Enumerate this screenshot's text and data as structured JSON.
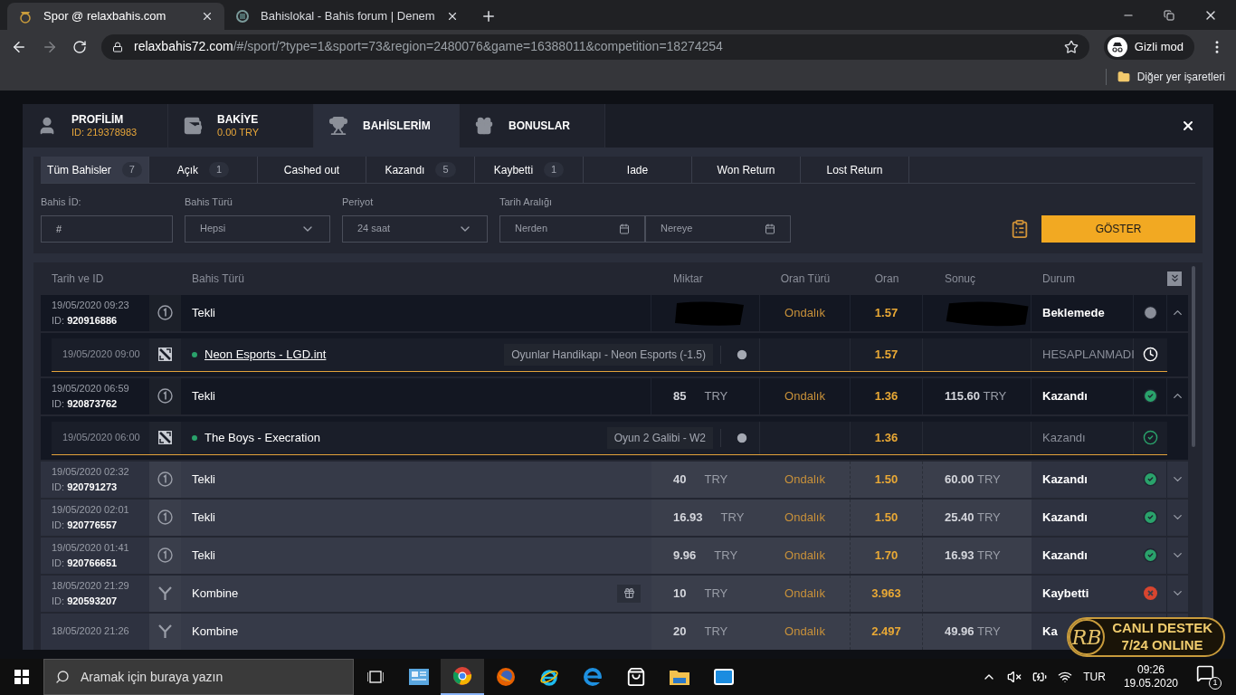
{
  "browser": {
    "tabs": [
      {
        "title": "Spor @ relaxbahis.com",
        "selected": true
      },
      {
        "title": "Bahislokal - Bahis forum | Denem",
        "selected": false
      }
    ],
    "url": {
      "domain": "relaxbahis72.com",
      "path": "/#/sport/?type=1&sport=73&region=2480076&game=16388011&competition=18274254"
    },
    "profile_label": "Gizli mod",
    "bookmarks": [
      "Diğer yer işaretleri"
    ]
  },
  "account_tabs": [
    {
      "label": "PROFİLİM",
      "sublabel": "ID: 219378983",
      "selected": false
    },
    {
      "label": "BAKİYE",
      "sublabel": "0.00 TRY",
      "selected": false
    },
    {
      "label": "BAHİSLERİM",
      "selected": true
    },
    {
      "label": "BONUSLAR",
      "selected": false
    }
  ],
  "bet_filters": [
    {
      "label": "Tüm Bahisler",
      "count": "7",
      "selected": true
    },
    {
      "label": "Açık",
      "count": "1",
      "selected": false
    },
    {
      "label": "Cashed out",
      "selected": false
    },
    {
      "label": "Kazandı",
      "count": "5",
      "selected": false
    },
    {
      "label": "Kaybetti",
      "count": "1",
      "selected": false
    },
    {
      "label": "Iade",
      "selected": false
    },
    {
      "label": "Won Return",
      "selected": false
    },
    {
      "label": "Lost Return",
      "selected": false
    }
  ],
  "filters": {
    "bet_id": {
      "label": "Bahis İD:",
      "placeholder": "#"
    },
    "bet_type": {
      "label": "Bahis Türü",
      "value": "Hepsi"
    },
    "period": {
      "label": "Periyot",
      "value": "24 saat"
    },
    "date_range": {
      "label": "Tarih Aralığı",
      "from_placeholder": "Nerden",
      "to_placeholder": "Nereye"
    },
    "submit": "GÖSTER"
  },
  "table": {
    "columns": [
      "Tarih ve ID",
      "Bahis Türü",
      "Miktar",
      "Oran Türü",
      "Oran",
      "Sonuç",
      "Durum"
    ],
    "rows": [
      {
        "kind": "bet",
        "date": "19/05/2020 09:23",
        "id_label": "ID:",
        "id": "920916886",
        "type": {
          "text": "Tekli",
          "kind": "single"
        },
        "redacted": true,
        "odds_type": "Ondalık",
        "odds": "1.57",
        "status": {
          "text": "Beklemede",
          "kind": "pending"
        },
        "expanded": true
      },
      {
        "kind": "selection",
        "date": "19/05/2020 09:00",
        "match": "Neon Esports - LGD.int",
        "link": true,
        "market": "Oyunlar Handikapı - Neon Esports (-1.5)",
        "odds": "1.57",
        "status": {
          "text": "HESAPLANMADI",
          "kind": "pending"
        }
      },
      {
        "kind": "bet",
        "date": "19/05/2020 06:59",
        "id_label": "ID:",
        "id": "920873762",
        "type": {
          "text": "Tekli",
          "kind": "single"
        },
        "amount": "85",
        "currency": "TRY",
        "odds_type": "Ondalık",
        "odds": "1.36",
        "result": "115.60",
        "result_currency": "TRY",
        "status": {
          "text": "Kazandı",
          "kind": "won"
        },
        "expanded": true
      },
      {
        "kind": "selection",
        "date": "19/05/2020 06:00",
        "match": "The Boys - Execration",
        "link": false,
        "market": "Oyun 2 Galibi - W2",
        "odds": "1.36",
        "status": {
          "text": "Kazandı",
          "kind": "won"
        }
      },
      {
        "kind": "bet",
        "date": "19/05/2020 02:32",
        "id_label": "ID:",
        "id": "920791273",
        "type": {
          "text": "Tekli",
          "kind": "single"
        },
        "amount": "40",
        "currency": "TRY",
        "odds_type": "Ondalık",
        "odds": "1.50",
        "result": "60.00",
        "result_currency": "TRY",
        "status": {
          "text": "Kazandı",
          "kind": "won"
        },
        "expanded": false
      },
      {
        "kind": "bet",
        "date": "19/05/2020 02:01",
        "id_label": "ID:",
        "id": "920776557",
        "type": {
          "text": "Tekli",
          "kind": "single"
        },
        "amount": "16.93",
        "currency": "TRY",
        "odds_type": "Ondalık",
        "odds": "1.50",
        "result": "25.40",
        "result_currency": "TRY",
        "status": {
          "text": "Kazandı",
          "kind": "won"
        },
        "expanded": false
      },
      {
        "kind": "bet",
        "date": "19/05/2020 01:41",
        "id_label": "ID:",
        "id": "920766651",
        "type": {
          "text": "Tekli",
          "kind": "single"
        },
        "amount": "9.96",
        "currency": "TRY",
        "odds_type": "Ondalık",
        "odds": "1.70",
        "result": "16.93",
        "result_currency": "TRY",
        "status": {
          "text": "Kazandı",
          "kind": "won"
        },
        "expanded": false
      },
      {
        "kind": "bet",
        "date": "18/05/2020 21:29",
        "id_label": "ID:",
        "id": "920593207",
        "type": {
          "text": "Kombine",
          "kind": "combo"
        },
        "gift": true,
        "amount": "10",
        "currency": "TRY",
        "odds_type": "Ondalık",
        "odds": "3.963",
        "status": {
          "text": "Kaybetti",
          "kind": "lost"
        },
        "expanded": false
      },
      {
        "kind": "bet",
        "date": "18/05/2020 21:26",
        "type": {
          "text": "Kombine",
          "kind": "combo"
        },
        "amount": "20",
        "currency": "TRY",
        "odds_type": "Ondalık",
        "odds": "2.497",
        "result": "49.96",
        "result_currency": "TRY",
        "status": {
          "text": "Ka"
        }
      }
    ]
  },
  "support_badge": {
    "logo_text": "RB",
    "lines": [
      "CANLI DESTEK",
      "7/24 ONLINE"
    ]
  },
  "taskbar": {
    "search_placeholder": "Aramak için buraya yazın",
    "language": "TUR",
    "time": "09:26",
    "date": "19.05.2020",
    "notifications": "1"
  }
}
